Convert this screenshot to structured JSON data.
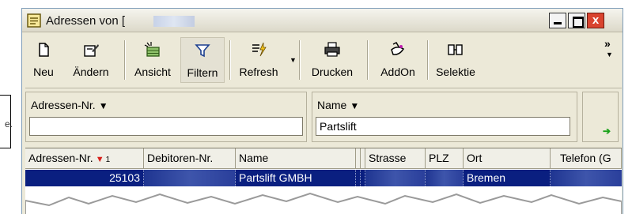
{
  "window": {
    "title": "Adressen von [",
    "close_glyph": "x"
  },
  "toolbar": {
    "items": [
      {
        "label": "Neu",
        "icon": "new-document-icon"
      },
      {
        "label": "Ändern",
        "icon": "edit-icon"
      },
      {
        "label": "Ansicht",
        "icon": "view-icon"
      },
      {
        "label": "Filtern",
        "icon": "filter-icon"
      },
      {
        "label": "Refresh",
        "icon": "refresh-icon"
      },
      {
        "label": "Drucken",
        "icon": "printer-icon"
      },
      {
        "label": "AddOn",
        "icon": "addon-icon"
      },
      {
        "label": "Selektie",
        "icon": "selection-icon"
      }
    ],
    "more_glyph": "»"
  },
  "filter": {
    "fields": [
      {
        "label": "Adressen-Nr.",
        "value": ""
      },
      {
        "label": "Name",
        "value": "Partslift"
      }
    ]
  },
  "grid": {
    "columns": [
      "Adressen-Nr.",
      "Debitoren-Nr.",
      "Name",
      "Strasse",
      "PLZ",
      "Ort",
      "Telefon (G"
    ],
    "sort_marker": "1",
    "rows": [
      {
        "adressen_nr": "25103",
        "debitoren_nr": "",
        "name": "Partslift GMBH",
        "strasse": "",
        "plz": "",
        "ort": "Bremen",
        "telefon": ""
      }
    ]
  },
  "colors": {
    "selection": "#0a1f80",
    "close_button": "#d9442f",
    "sort_arrow": "#d8201b",
    "go_arrow": "#1aa21a"
  }
}
